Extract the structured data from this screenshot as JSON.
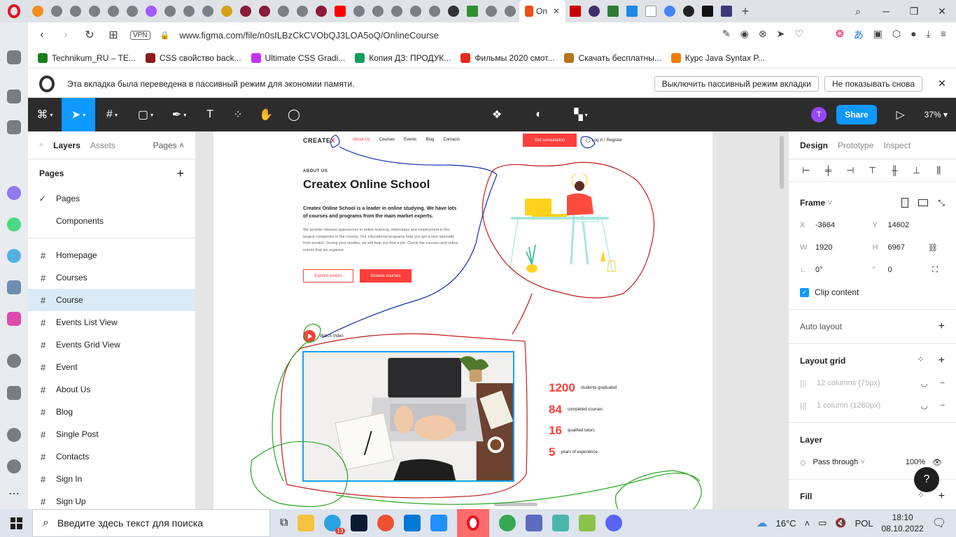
{
  "browser": {
    "active_tab_label": "On",
    "url": "www.figma.com/file/n0sILBzCkCVObQJ3LOA5oQ/OnlineCourse",
    "vpn_label": "VPN",
    "bookmarks": [
      {
        "label": "Technikum_RU – TE...",
        "color": "#1a7f1a"
      },
      {
        "label": "CSS свойство back...",
        "color": "#8c1a1a"
      },
      {
        "label": "Ultimate CSS Gradi...",
        "color": "#c233ff"
      },
      {
        "label": "Копия ДЗ: ПРОДУК...",
        "color": "#0f9d58"
      },
      {
        "label": "Фильмы 2020 смот...",
        "color": "#e8291c"
      },
      {
        "label": "Скачать бесплатны...",
        "color": "#b5751b"
      },
      {
        "label": "Курс Java Syntax P...",
        "color": "#f57c00"
      }
    ],
    "infobar": {
      "message": "Эта вкладка была переведена в пассивный режим для экономии памяти.",
      "btn_disable": "Выключить пассивный режим вкладки",
      "btn_dont_show": "Не показывать снова"
    }
  },
  "figma": {
    "toolbar": {
      "user_initial": "T",
      "share_label": "Share",
      "zoom_label": "37%"
    },
    "left_panel": {
      "tab_layers": "Layers",
      "tab_assets": "Assets",
      "pages_selector": "Pages",
      "pages_heading": "Pages",
      "pages": [
        {
          "label": "Pages",
          "checked": true
        },
        {
          "label": "Components",
          "checked": false
        }
      ],
      "frames": [
        {
          "label": "Homepage",
          "selected": false
        },
        {
          "label": "Courses",
          "selected": false
        },
        {
          "label": "Course",
          "selected": true
        },
        {
          "label": "Events List View",
          "selected": false
        },
        {
          "label": "Events Grid View",
          "selected": false
        },
        {
          "label": "Event",
          "selected": false
        },
        {
          "label": "About Us",
          "selected": false
        },
        {
          "label": "Blog",
          "selected": false
        },
        {
          "label": "Single Post",
          "selected": false
        },
        {
          "label": "Contacts",
          "selected": false
        },
        {
          "label": "Sign In",
          "selected": false
        },
        {
          "label": "Sign Up",
          "selected": false
        }
      ]
    },
    "canvas": {
      "logo_text": "CREATE",
      "logo_accent": "X",
      "menu": [
        "About Us",
        "Courses",
        "Events",
        "Blog",
        "Contacts"
      ],
      "consult_btn": "Get consultation",
      "login": "Log in / Register",
      "about_label": "ABOUT US",
      "title": "Createx Online School",
      "lead": "Createx Online School is a leader in online studying. We have lots of courses and programs from the main market experts.",
      "body": "We provide relevant approaches to online learning, internships and employment in the largest companies in the country. Our educational programs help you get a new specialty from scratch. During your studies, we will help you find a job. Check the courses and online events that we organize.",
      "btn_explore": "Explore events",
      "btn_browse": "Browse courses",
      "watch_video": "Watch Video",
      "stats": [
        {
          "num": "1200",
          "label": "students graduated"
        },
        {
          "num": "84",
          "label": "completed courses"
        },
        {
          "num": "16",
          "label": "qualified tutors"
        },
        {
          "num": "5",
          "label": "years of experience"
        }
      ],
      "accent_color": "#ff3f3a"
    },
    "right_panel": {
      "tab_design": "Design",
      "tab_prototype": "Prototype",
      "tab_inspect": "Inspect",
      "frame_heading": "Frame",
      "x_label": "X",
      "x_value": "-3664",
      "y_label": "Y",
      "y_value": "14602",
      "w_label": "W",
      "w_value": "1920",
      "h_label": "H",
      "h_value": "6967",
      "rotation_value": "0°",
      "radius_value": "0",
      "clip_content": "Clip content",
      "auto_layout": "Auto layout",
      "layout_grid": "Layout grid",
      "grids": [
        "12 columns (75px)",
        "1 column (1260px)"
      ],
      "layer_heading": "Layer",
      "blend_mode": "Pass through",
      "opacity": "100%",
      "fill_heading": "Fill"
    }
  },
  "taskbar": {
    "search_placeholder": "Введите здесь текст для поиска",
    "telegram_badge": "13",
    "weather": "16°C",
    "lang": "POL",
    "time": "18:10",
    "date": "08.10.2022"
  }
}
